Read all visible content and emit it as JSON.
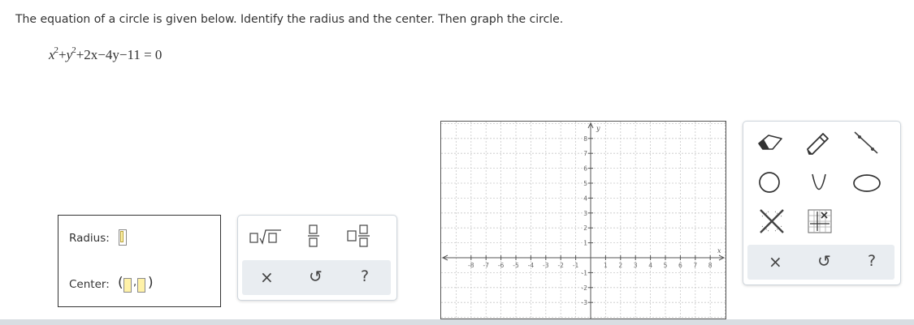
{
  "question": "The equation of a circle is given below. Identify the radius and the center. Then graph the circle.",
  "equation": {
    "x_term": "x",
    "exp": "2",
    "plus1": "+",
    "y_term": "y",
    "exp2": "2",
    "rest": "+2x−4y−11 = 0"
  },
  "answer": {
    "radius_label": "Radius:",
    "center_label": "Center:",
    "open_paren": "(",
    "comma": ",",
    "close_paren": ")"
  },
  "math_palette": {
    "icons": [
      "sqrt-icon",
      "fraction-icon",
      "mixed-number-icon"
    ],
    "clear_glyph": "×",
    "undo_glyph": "↺",
    "help_glyph": "?"
  },
  "graph": {
    "x_label": "x",
    "y_label": "y",
    "x_ticks": [
      "-8",
      "-7",
      "-6",
      "-5",
      "-4",
      "-3",
      "-2",
      "-1",
      "1",
      "2",
      "3",
      "4",
      "5",
      "6",
      "7",
      "8"
    ],
    "y_ticks": [
      "8",
      "7",
      "6",
      "5",
      "4",
      "3",
      "2",
      "1",
      "-1",
      "-2",
      "-3"
    ],
    "x_range": [
      -9,
      10
    ],
    "y_range": [
      -4,
      9
    ]
  },
  "tool_palette": {
    "tools": [
      "eraser-icon",
      "pencil-icon",
      "line-segment-icon",
      "circle-tool-icon",
      "parabola-tool-icon",
      "ellipse-tool-icon",
      "no-solution-icon",
      "grid-tool-icon"
    ],
    "clear_glyph": "×",
    "undo_glyph": "↺",
    "help_glyph": "?"
  }
}
